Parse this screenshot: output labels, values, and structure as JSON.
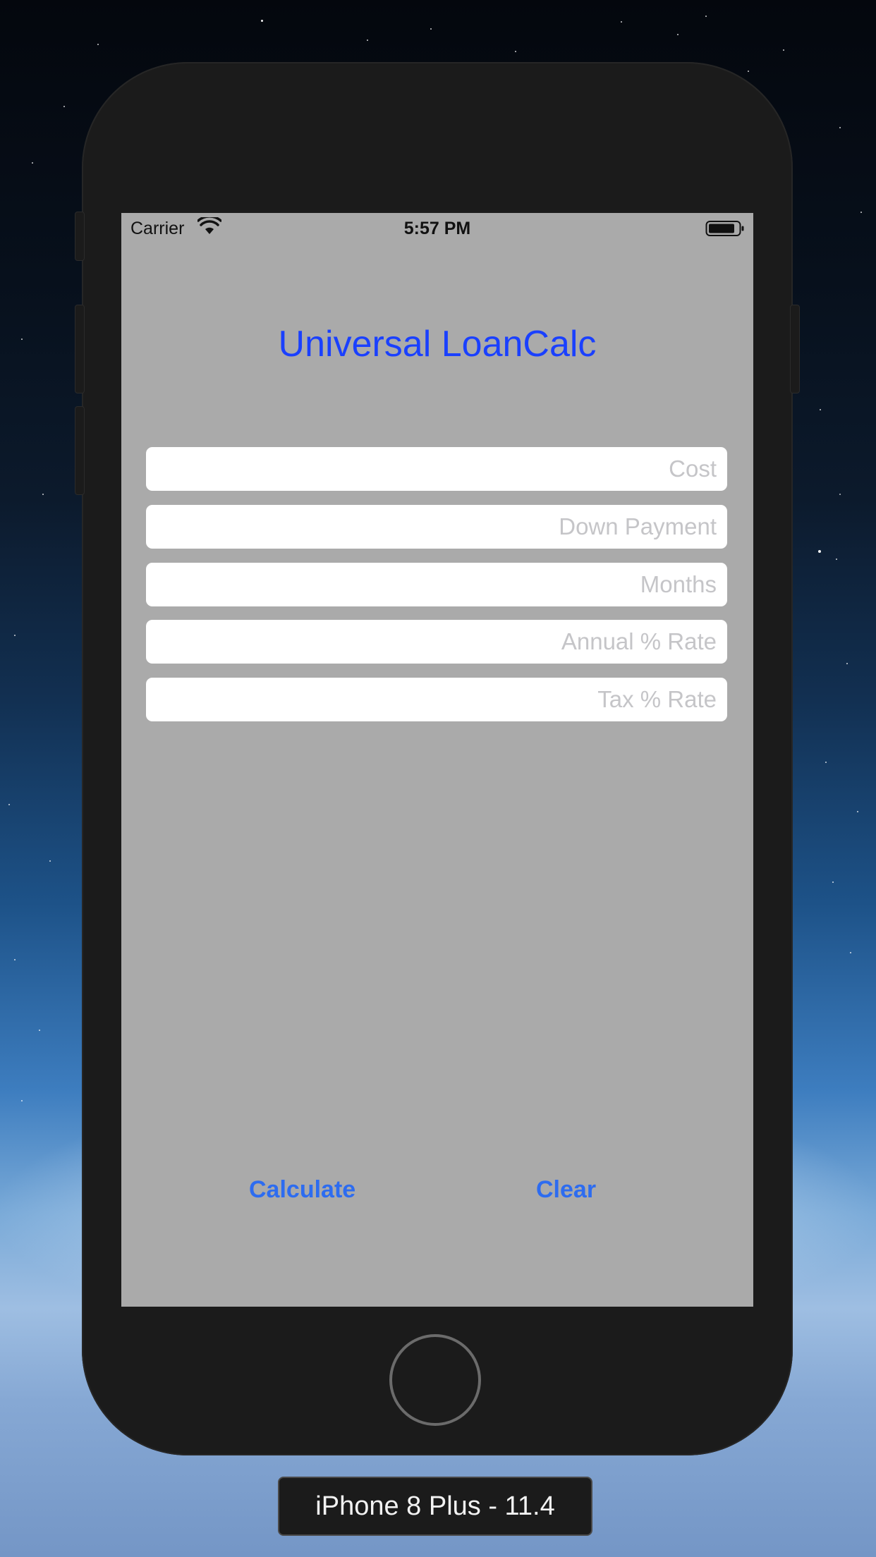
{
  "simulator": {
    "device_label": "iPhone 8 Plus - 11.4"
  },
  "status_bar": {
    "carrier": "Carrier",
    "time": "5:57 PM",
    "wifi_icon": "wifi-icon",
    "battery_icon": "battery-icon"
  },
  "app": {
    "title": "Universal LoanCalc",
    "title_color": "#1a40ff",
    "background_color": "#aaaaaa",
    "fields": [
      {
        "value": "",
        "placeholder": "Cost"
      },
      {
        "value": "",
        "placeholder": "Down Payment"
      },
      {
        "value": "",
        "placeholder": "Months"
      },
      {
        "value": "",
        "placeholder": "Annual % Rate"
      },
      {
        "value": "",
        "placeholder": "Tax % Rate"
      }
    ],
    "buttons": {
      "calculate": "Calculate",
      "clear": "Clear",
      "color": "#2d6cf0"
    }
  }
}
